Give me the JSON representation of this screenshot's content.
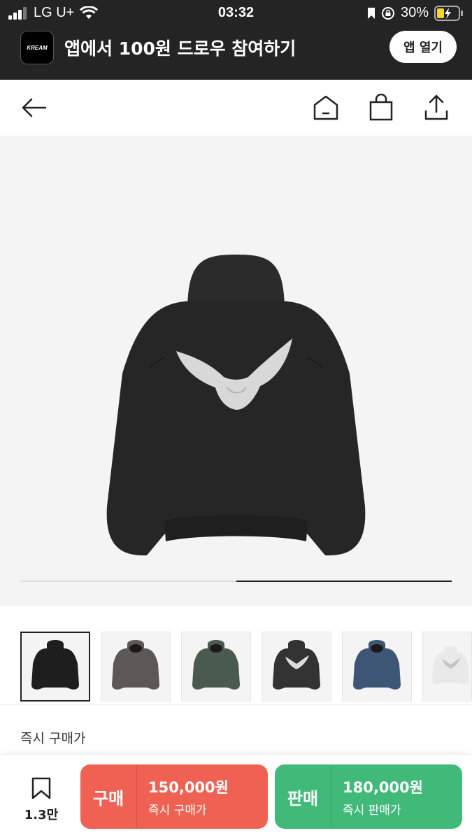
{
  "status_bar": {
    "carrier": "LG U+",
    "time": "03:32",
    "battery": "30%"
  },
  "banner": {
    "logo_text": "KREAM",
    "title": "앱에서 100원 드로우 참여하기",
    "open_button": "앱 열기"
  },
  "product": {
    "image_progress": 0.5,
    "thumbnail_count": 6,
    "selected_thumbnail": 0,
    "price_label": "즉시 구매가"
  },
  "bottom": {
    "wish_count": "1.3만",
    "buy": {
      "label": "구매",
      "price": "150,000원",
      "sub": "즉시 구매가"
    },
    "sell": {
      "label": "판매",
      "price": "180,000원",
      "sub": "즉시 판매가"
    }
  },
  "colors": {
    "buy": "#ef6253",
    "sell": "#41b979",
    "banner_bg": "#242424"
  }
}
